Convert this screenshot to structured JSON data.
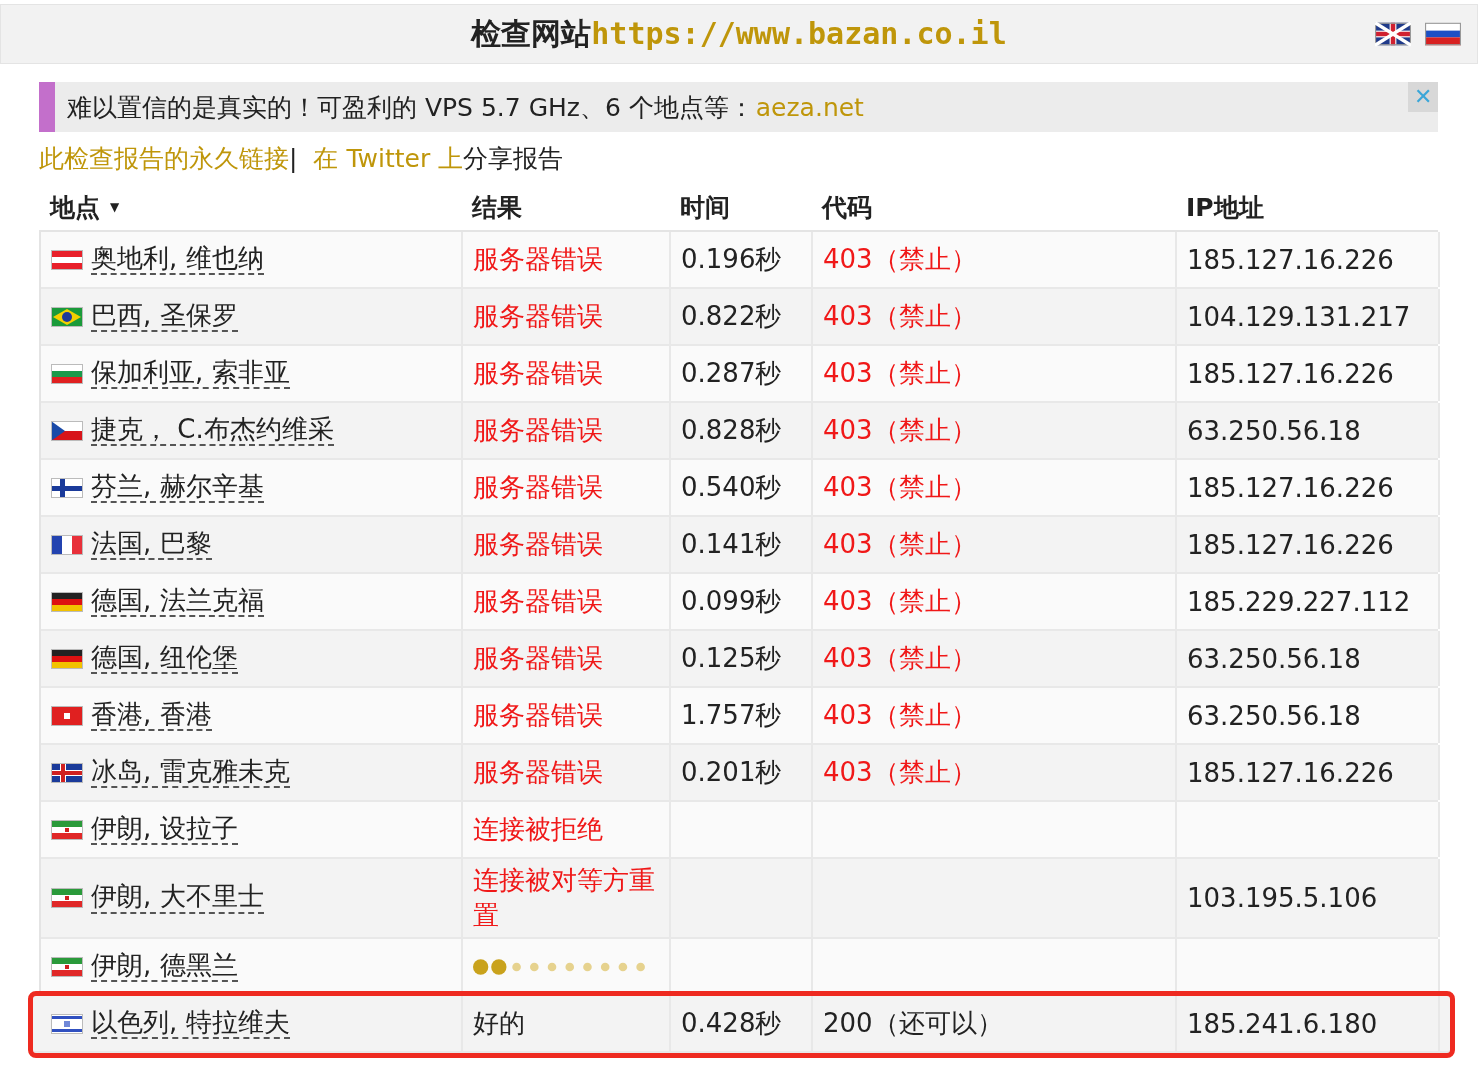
{
  "header": {
    "title": "检查网站",
    "url": "https://www.bazan.co.il",
    "languages": [
      {
        "kind": "gb"
      },
      {
        "kind": "ru"
      }
    ]
  },
  "ad": {
    "text": "难以置信的是真实的！可盈利的 VPS 5.7 GHz、6 个地点等：",
    "link": "aeza.net",
    "close": "✕"
  },
  "links": {
    "permalink": "此检查报告的永久链接",
    "separator": "|",
    "share_link": "在 Twitter 上",
    "share_text": "分享报告"
  },
  "table": {
    "columns": [
      {
        "label": "地点",
        "sort": "▼"
      },
      {
        "label": "结果"
      },
      {
        "label": "时间"
      },
      {
        "label": "代码"
      },
      {
        "label": "IP地址"
      }
    ],
    "rows": [
      {
        "flag": {
          "kind": "at"
        },
        "location": "奥地利, 维也纳",
        "result": "服务器错误",
        "kind": "error",
        "time": "0.196秒",
        "code": "403（禁止）",
        "ip": "185.127.16.226",
        "highlighted": false
      },
      {
        "flag": {
          "kind": "br"
        },
        "location": "巴西, 圣保罗",
        "result": "服务器错误",
        "kind": "error",
        "time": "0.822秒",
        "code": "403（禁止）",
        "ip": "104.129.131.217",
        "highlighted": false
      },
      {
        "flag": {
          "kind": "bg"
        },
        "location": "保加利亚, 索非亚",
        "result": "服务器错误",
        "kind": "error",
        "time": "0.287秒",
        "code": "403（禁止）",
        "ip": "185.127.16.226",
        "highlighted": false
      },
      {
        "flag": {
          "kind": "cz"
        },
        "location": "捷克， C.布杰约维采",
        "result": "服务器错误",
        "kind": "error",
        "time": "0.828秒",
        "code": "403（禁止）",
        "ip": "63.250.56.18",
        "highlighted": false
      },
      {
        "flag": {
          "kind": "fi"
        },
        "location": "芬兰, 赫尔辛基",
        "result": "服务器错误",
        "kind": "error",
        "time": "0.540秒",
        "code": "403（禁止）",
        "ip": "185.127.16.226",
        "highlighted": false
      },
      {
        "flag": {
          "kind": "fr"
        },
        "location": "法国, 巴黎",
        "result": "服务器错误",
        "kind": "error",
        "time": "0.141秒",
        "code": "403（禁止）",
        "ip": "185.127.16.226",
        "highlighted": false
      },
      {
        "flag": {
          "kind": "de"
        },
        "location": "德国, 法兰克福",
        "result": "服务器错误",
        "kind": "error",
        "time": "0.099秒",
        "code": "403（禁止）",
        "ip": "185.229.227.112",
        "highlighted": false
      },
      {
        "flag": {
          "kind": "de"
        },
        "location": "德国, 纽伦堡",
        "result": "服务器错误",
        "kind": "error",
        "time": "0.125秒",
        "code": "403（禁止）",
        "ip": "63.250.56.18",
        "highlighted": false
      },
      {
        "flag": {
          "kind": "hk"
        },
        "location": "香港, 香港",
        "result": "服务器错误",
        "kind": "error",
        "time": "1.757秒",
        "code": "403（禁止）",
        "ip": "63.250.56.18",
        "highlighted": false
      },
      {
        "flag": {
          "kind": "is"
        },
        "location": "冰岛, 雷克雅未克",
        "result": "服务器错误",
        "kind": "error",
        "time": "0.201秒",
        "code": "403（禁止）",
        "ip": "185.127.16.226",
        "highlighted": false
      },
      {
        "flag": {
          "kind": "ir"
        },
        "location": "伊朗, 设拉子",
        "result": "连接被拒绝",
        "kind": "error",
        "highlighted": false
      },
      {
        "flag": {
          "kind": "ir"
        },
        "location": "伊朗, 大不里士",
        "result": "连接被对等方重置",
        "kind": "error",
        "ip": "103.195.5.106",
        "highlighted": false
      },
      {
        "flag": {
          "kind": "ir"
        },
        "location": "伊朗, 德黑兰",
        "kind": "pending",
        "highlighted": false
      },
      {
        "flag": {
          "kind": "il"
        },
        "location": "以色列, 特拉维夫",
        "result": "好的",
        "kind": "ok",
        "time": "0.428秒",
        "code": "200（还可以）",
        "ip": "185.241.6.180",
        "highlighted": true
      }
    ]
  }
}
